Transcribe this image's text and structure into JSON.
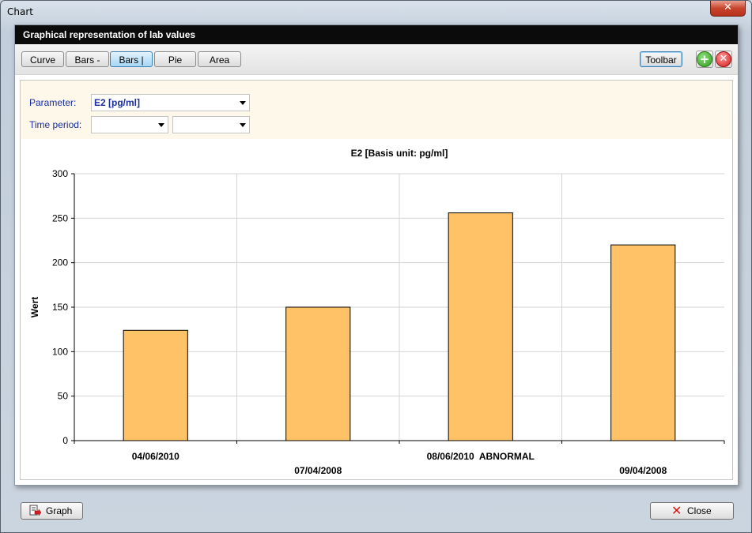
{
  "window": {
    "title": "Chart",
    "close_glyph": "✕"
  },
  "panel": {
    "header": "Graphical representation of lab values"
  },
  "toolbar": {
    "chart_types": [
      {
        "label": "Curve",
        "active": false
      },
      {
        "label": "Bars -",
        "active": false
      },
      {
        "label": "Bars |",
        "active": true
      },
      {
        "label": "Pie",
        "active": false
      },
      {
        "label": "Area",
        "active": false
      }
    ],
    "toolbar_label": "Toolbar",
    "add_icon": "plus-icon",
    "remove_icon": "remove-icon"
  },
  "filters": {
    "parameter_label": "Parameter:",
    "parameter_value": "E2 [pg/ml]",
    "time_period_label": "Time period:",
    "time_from": "",
    "time_to": ""
  },
  "footer": {
    "graph_label": "Graph",
    "close_label": "Close"
  },
  "colors": {
    "bar_fill": "#ffc266",
    "bar_stroke": "#000000",
    "grid": "#d4d4d4",
    "active_tab": "#a6d6f5"
  },
  "chart_data": {
    "type": "bar",
    "title": "E2   [Basis unit: pg/ml]",
    "ylabel": "Wert",
    "xlabel": "",
    "categories": [
      "04/06/2010",
      "07/04/2008",
      "08/06/2010  ABNORMAL",
      "09/04/2008"
    ],
    "values": [
      124,
      150,
      256,
      220
    ],
    "ylim": [
      0,
      300
    ],
    "yticks": [
      0,
      50,
      100,
      150,
      200,
      250,
      300
    ],
    "grid": true,
    "legend": "none"
  }
}
